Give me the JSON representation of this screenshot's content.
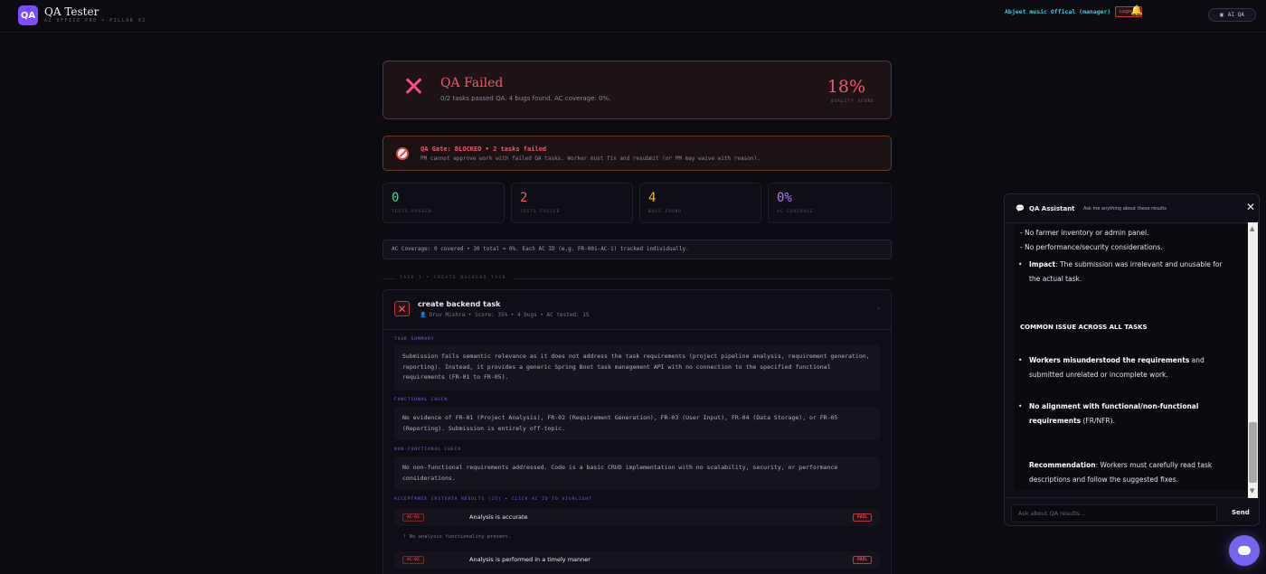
{
  "header": {
    "logo_text": "QA",
    "title": "QA Tester",
    "subtitle": "AI OFFICE PRO • PILLAR 02",
    "user": "Abjeet music Offical (manager)",
    "logout_label": "Logout",
    "ai_qa_label": "AI QA"
  },
  "summary": {
    "icon": "close-x-icon",
    "title": "QA Failed",
    "subtitle": "0/2 tasks passed QA. 4 bugs found. AC coverage: 0%.",
    "score": "18%",
    "score_label": "QUALITY SCORE"
  },
  "gate": {
    "icon": "no-entry-icon",
    "title": "QA Gate: BLOCKED • 2 tasks failed",
    "subtitle": "PM cannot approve work with failed QA tasks. Worker must fix and resubmit (or PM may waive with reason)."
  },
  "stats": [
    {
      "value": "0",
      "label": "TESTS PASSED",
      "color": "#3ddc84"
    },
    {
      "value": "2",
      "label": "TESTS FAILED",
      "color": "#ef5a6a"
    },
    {
      "value": "4",
      "label": "BUGS FOUND",
      "color": "#f2b233"
    },
    {
      "value": "0%",
      "label": "AC COVERAGE",
      "color": "#b07cff"
    }
  ],
  "coverage_note": "AC Coverage: 0 covered • 30 total = 0%. Each AC ID (e.g. FR-001-AC-1) tracked individually.",
  "task_section_label": "TASK 1 • CREATE BACKEND TASK",
  "task": {
    "title": "create backend task",
    "meta": "Druv Mishra • Score: 35% • 4 bugs • AC tested: 15",
    "summary_label": "TASK SUMMARY",
    "summary": "Submission fails semantic relevance as it does not address the task requirements (project pipeline analysis, requirement generation, reporting). Instead, it provides a generic Spring Boot task management API with no connection to the specified functional requirements (FR-01 to FR-05).",
    "functional_label": "FUNCTIONAL CHECK",
    "functional": "No evidence of FR-01 (Project Analysis), FR-02 (Requirement Generation), FR-03 (User Input), FR-04 (Data Storage), or FR-05 (Reporting). Submission is entirely off-topic.",
    "nonfunctional_label": "NON-FUNCTIONAL CHECK",
    "nonfunctional": "No non-functional requirements addressed. Code is a basic CRUD implementation with no scalability, security, or performance considerations.",
    "ac_label": "ACCEPTANCE CRITERIA RESULTS (15) • CLICK AC ID TO HIGHLIGHT",
    "ac": [
      {
        "id": "AC-01",
        "text": "Analysis is accurate",
        "status": "FAIL",
        "note": "! No analysis functionality present."
      },
      {
        "id": "AC-02",
        "text": "Analysis is performed in a timely manner",
        "status": "FAIL"
      }
    ]
  },
  "chat": {
    "title": "QA Assistant",
    "subtitle": "Ask me anything about these results",
    "line1": "- No farmer inventory or admin panel.",
    "line2": "- No performance/security considerations.",
    "impact_label": "Impact",
    "impact_text": ": The submission was irrelevant and unusable for the actual task.",
    "common_heading": "COMMON ISSUE ACROSS ALL TASKS",
    "b1_bold": "Workers misunderstood the requirements",
    "b1_text": " and submitted unrelated or incomplete work.",
    "b2_bold": "No alignment with functional/non-functional requirements",
    "b2_text": " (FR/NFR).",
    "rec_label": "Recommendation",
    "rec_text": ": Workers must carefully read task descriptions and follow the suggested fixes.",
    "input_placeholder": "Ask about QA results...",
    "send_label": "Send"
  }
}
